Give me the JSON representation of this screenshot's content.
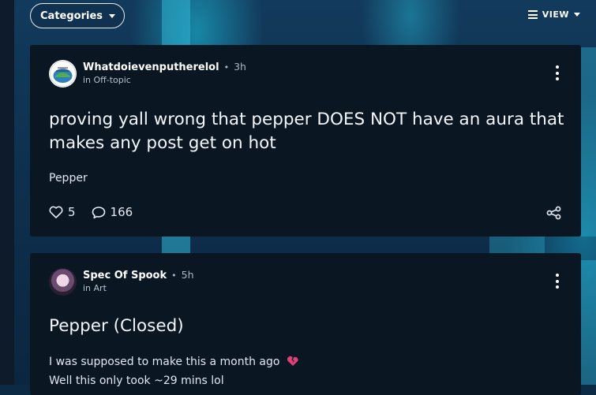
{
  "topbar": {
    "categories_label": "Categories",
    "view_label": "VIEW"
  },
  "posts": [
    {
      "author": "Whatdoievenputherelol",
      "time": "3h",
      "community": "in Off-topic",
      "title": "proving yall wrong that pepper DOES NOT have an aura that makes any post get on hot",
      "tag": "Pepper",
      "likes": "5",
      "comments": "166"
    },
    {
      "author": "Spec Of Spook",
      "time": "5h",
      "community": "in Art",
      "title": "Pepper (Closed)",
      "body_line_1": "I was supposed to make this a month ago",
      "body_line_2": "Well this only took ~29 mins lol"
    }
  ],
  "colors": {
    "card_bg": "#0a1723",
    "accent_heart": "#e0407a"
  },
  "icons": [
    "chevron-down-icon",
    "view-options-icon",
    "more-options-icon",
    "heart-icon",
    "comment-icon",
    "share-icon",
    "broken-heart-icon"
  ]
}
